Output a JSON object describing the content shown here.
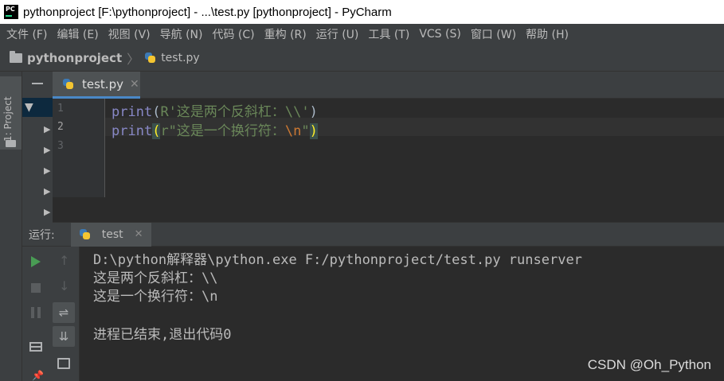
{
  "window": {
    "app_icon_text": "PC",
    "title": "pythonproject [F:\\pythonproject] - ...\\test.py [pythonproject] - PyCharm"
  },
  "menu": [
    {
      "label": "文件 (F)"
    },
    {
      "label": "编辑 (E)"
    },
    {
      "label": "视图 (V)"
    },
    {
      "label": "导航 (N)"
    },
    {
      "label": "代码 (C)"
    },
    {
      "label": "重构 (R)"
    },
    {
      "label": "运行 (U)"
    },
    {
      "label": "工具 (T)"
    },
    {
      "label": "VCS (S)"
    },
    {
      "label": "窗口 (W)"
    },
    {
      "label": "帮助 (H)"
    }
  ],
  "breadcrumb": {
    "project": "pythonproject",
    "file": "test.py"
  },
  "sidebar": {
    "project_tab_label": "1: Project"
  },
  "editor": {
    "tab_label": "test.py",
    "line_numbers": [
      "1",
      "2",
      "3"
    ],
    "lines": [
      {
        "fn": "print",
        "open": "(",
        "string": "R'这是两个反斜杠：\\\\'",
        "close": ")"
      },
      {
        "fn": "print",
        "open": "(",
        "string_prefix": "r\"这是一个换行符：",
        "escape": "\\n",
        "string_suffix": "\"",
        "close": ")"
      }
    ]
  },
  "run": {
    "label": "运行:",
    "tab_label": "test",
    "console": [
      "D:\\python解释器\\python.exe F:/pythonproject/test.py runserver",
      "这是两个反斜杠：\\\\",
      "这是一个换行符：\\n",
      "",
      "进程已结束,退出代码0"
    ]
  },
  "watermark": "CSDN @Oh_Python",
  "colors": {
    "accent": "#4a88c7",
    "run_green": "#499c54",
    "string_green": "#6a8759",
    "builtin_purple": "#8888c6"
  }
}
